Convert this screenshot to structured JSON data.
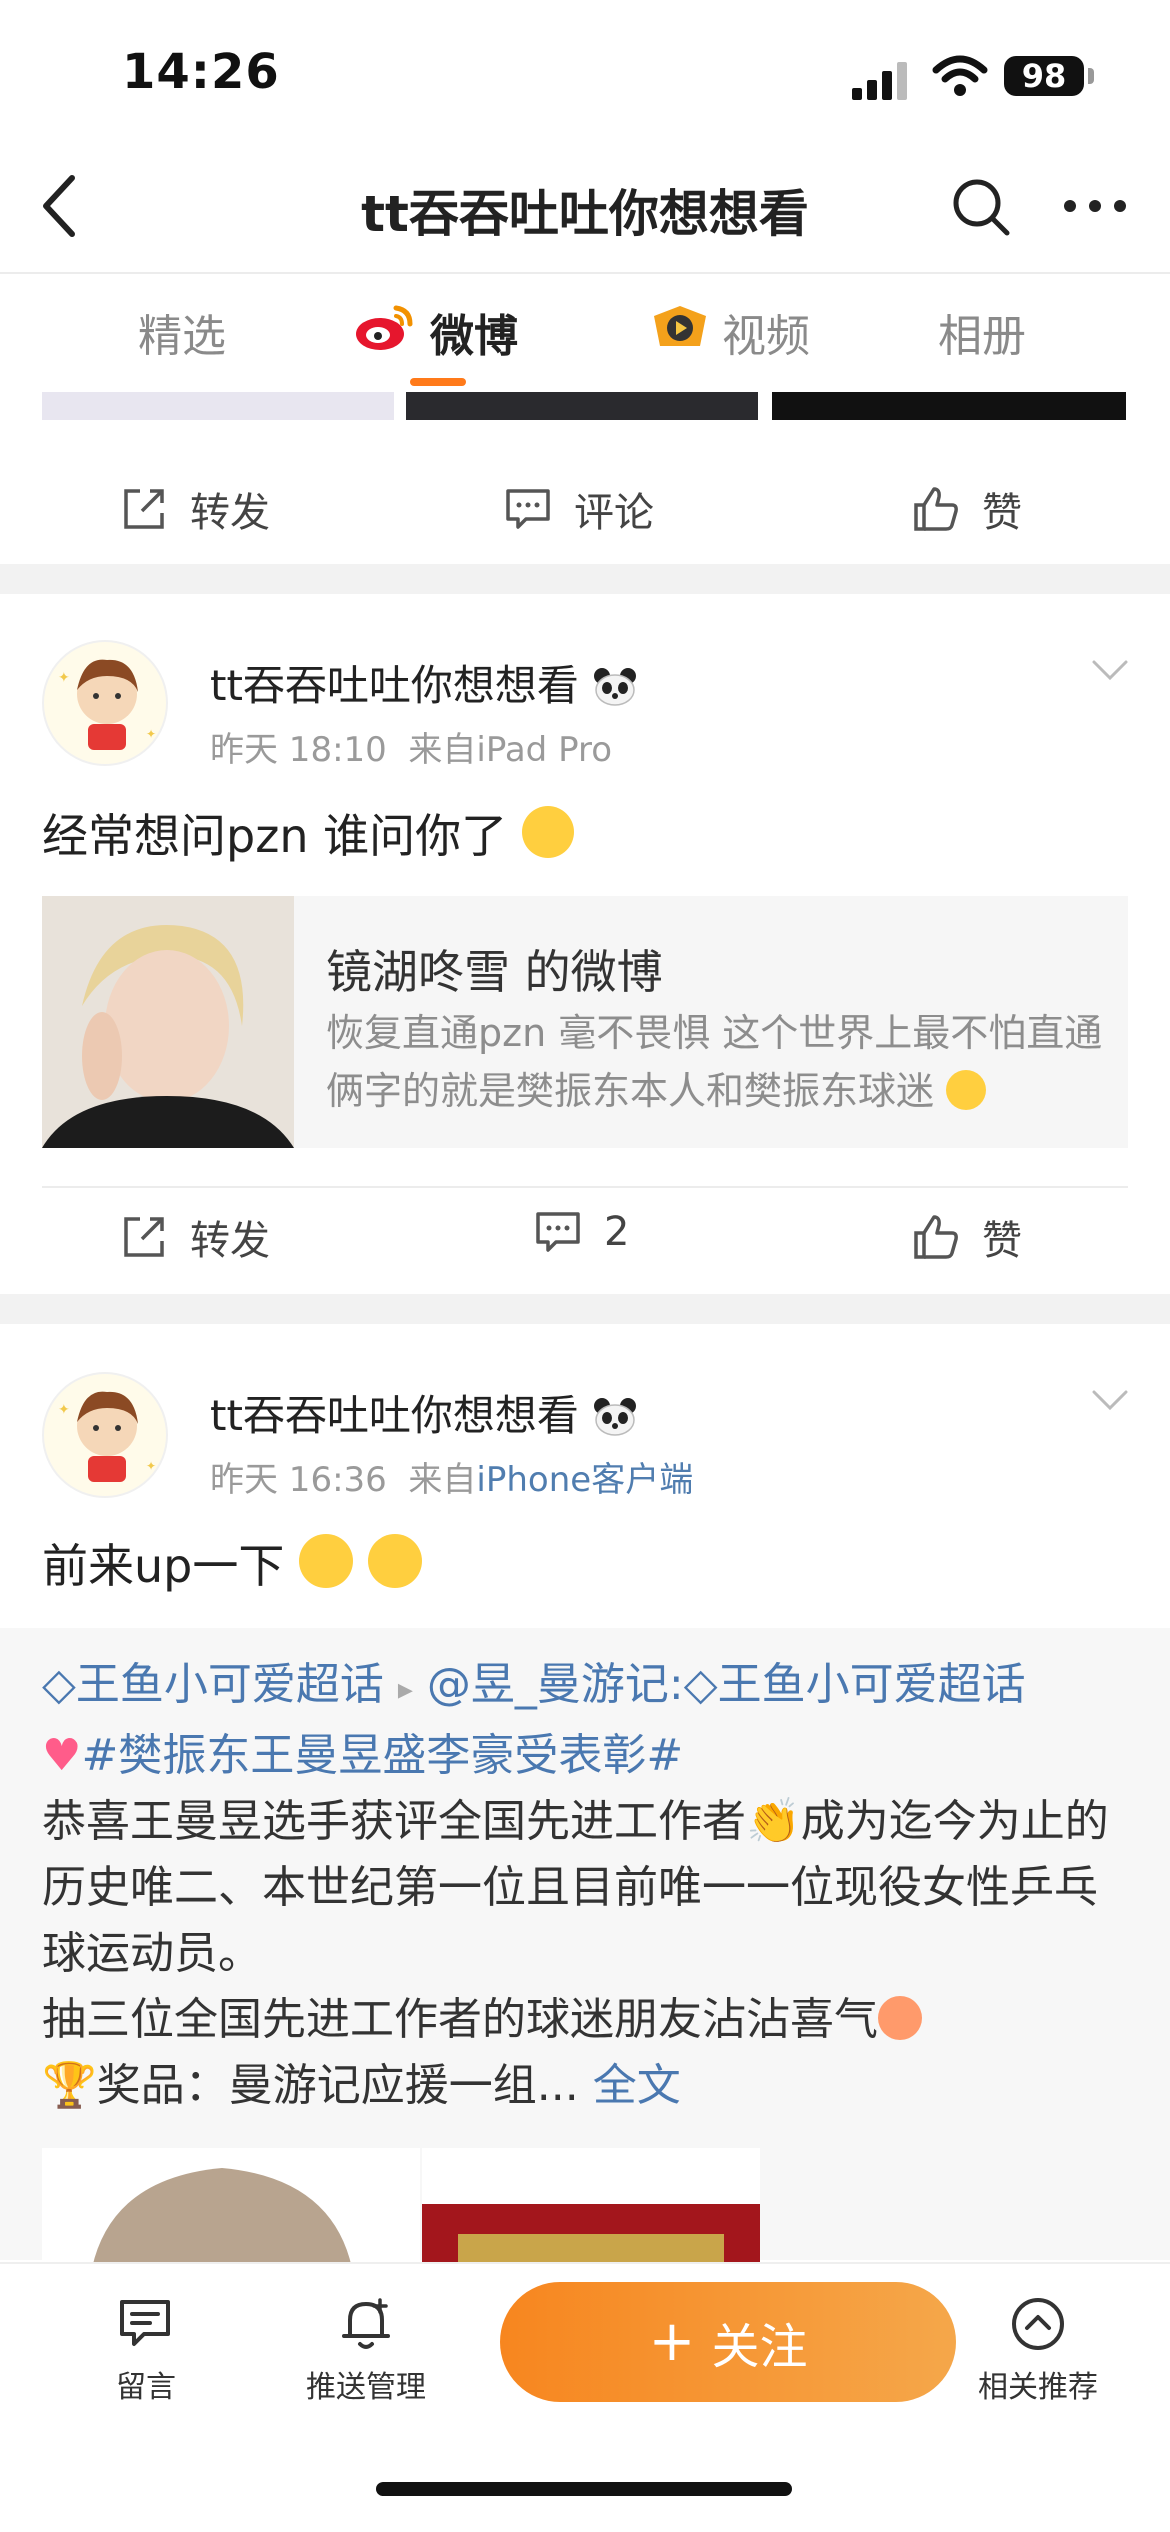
{
  "status_bar": {
    "time": "14:26",
    "battery": "98"
  },
  "header": {
    "title": "tt吞吞吐吐你想想看"
  },
  "tabs": [
    {
      "label": "精选"
    },
    {
      "label": "微博"
    },
    {
      "label": "视频"
    },
    {
      "label": "相册"
    }
  ],
  "actions": {
    "repost": "转发",
    "comment": "评论",
    "like": "赞"
  },
  "posts": [
    {
      "username": "tt吞吞吐吐你想想看",
      "time": "昨天 18:10",
      "source_prefix": "来自",
      "source": "iPad Pro",
      "text": "经常想问pzn 谁问你了",
      "quote": {
        "title": "镜湖咚雪 的微博",
        "text": "恢复直通pzn 毫不畏惧 这个世界上最不怕直通俩字的就是樊振东本人和樊振东球迷"
      },
      "comment_count": "2"
    },
    {
      "username": "tt吞吞吐吐你想想看",
      "time": "昨天 16:36",
      "source_prefix": "来自",
      "source": "iPhone客户端",
      "text": "前来up一下",
      "repost": {
        "topic1": "王鱼小可爱超话",
        "mention": "@昱_曼游记:",
        "topic2": "王鱼小可爱超话",
        "hashtag": "#樊振东王曼昱盛李豪受表彰#",
        "line1": "恭喜王曼昱选手获评全国先进工作者",
        "line2": "成为迄今为止的历史唯二、本世纪第一位且目前唯一一位现役女性乒乓球运动员。",
        "line3": "抽三位全国先进工作者的球迷朋友沾沾喜气",
        "line4": "奖品：曼游记应援一组...",
        "full_text": "全文"
      }
    }
  ],
  "bottom_bar": {
    "message": "留言",
    "push": "推送管理",
    "follow": "关注",
    "recommend": "相关推荐"
  },
  "colors": {
    "accent": "#ff7a1a",
    "link": "#4a78b0",
    "follow_start": "#f7861f",
    "follow_end": "#f5a74a"
  }
}
